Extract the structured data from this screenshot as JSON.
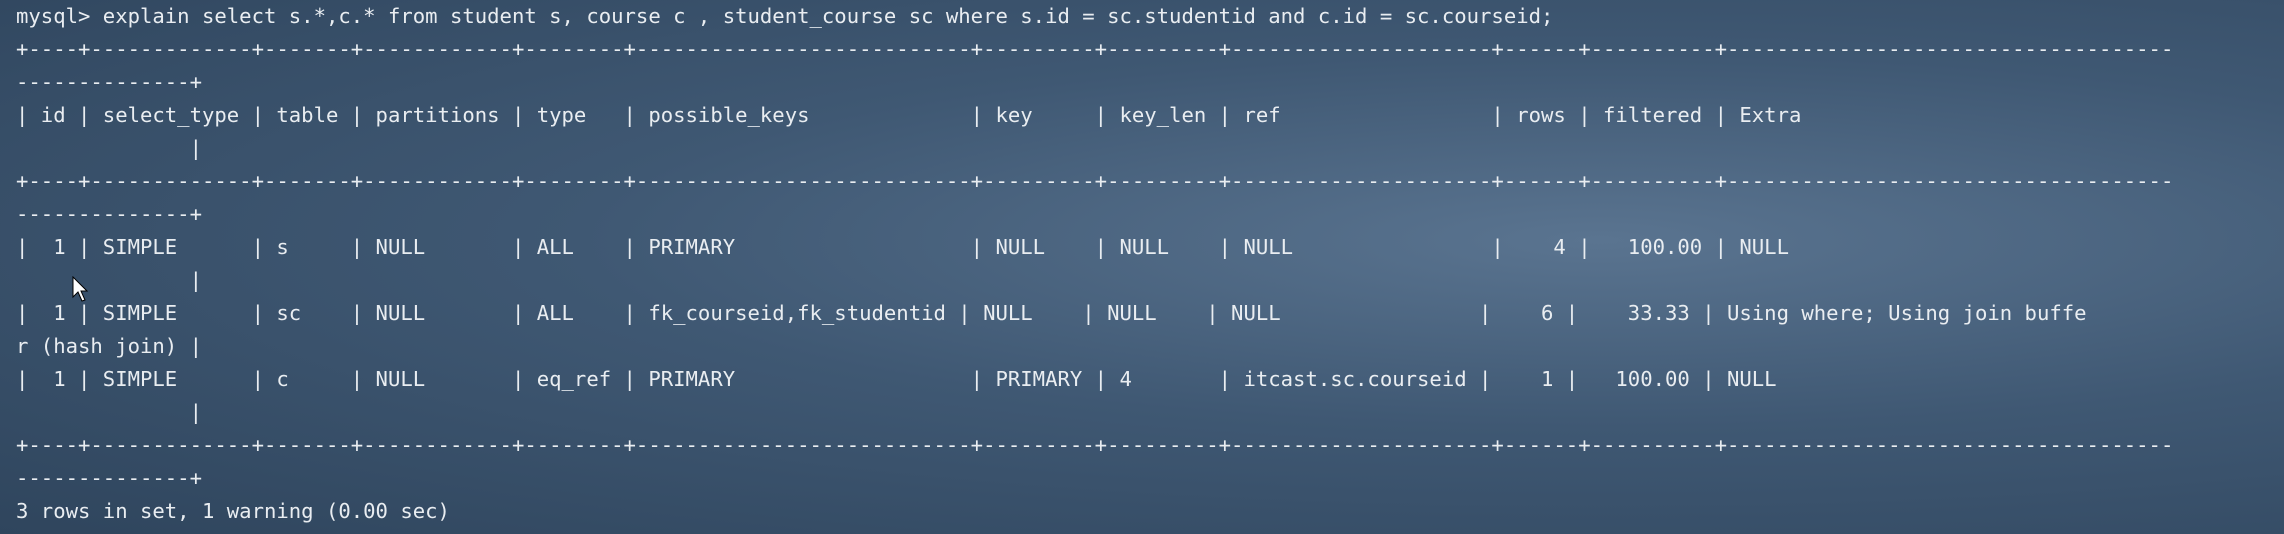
{
  "terminal": {
    "lines": [
      "mysql> explain select s.*,c.* from student s, course c , student_course sc where s.id = sc.studentid and c.id = sc.courseid;",
      "+----+-------------+-------+------------+--------+---------------------------+---------+---------+---------------------+------+----------+------------------------------------",
      "--------------+",
      "| id | select_type | table | partitions | type   | possible_keys             | key     | key_len | ref                 | rows | filtered | Extra",
      "              |",
      "+----+-------------+-------+------------+--------+---------------------------+---------+---------+---------------------+------+----------+------------------------------------",
      "--------------+",
      "|  1 | SIMPLE      | s     | NULL       | ALL    | PRIMARY                   | NULL    | NULL    | NULL                |    4 |   100.00 | NULL",
      "              |",
      "|  1 | SIMPLE      | sc    | NULL       | ALL    | fk_courseid,fk_studentid | NULL    | NULL    | NULL                |    6 |    33.33 | Using where; Using join buffe",
      "r (hash join) |",
      "|  1 | SIMPLE      | c     | NULL       | eq_ref | PRIMARY                   | PRIMARY | 4       | itcast.sc.courseid |    1 |   100.00 | NULL",
      "              |",
      "+----+-------------+-------+------------+--------+---------------------------+---------+---------+---------------------+------+----------+------------------------------------",
      "--------------+",
      "3 rows in set, 1 warning (0.00 sec)"
    ]
  },
  "colors": {
    "background": "#3f5873",
    "text": "#e9edf1"
  },
  "cursor": {
    "icon": "mouse-pointer-icon"
  }
}
